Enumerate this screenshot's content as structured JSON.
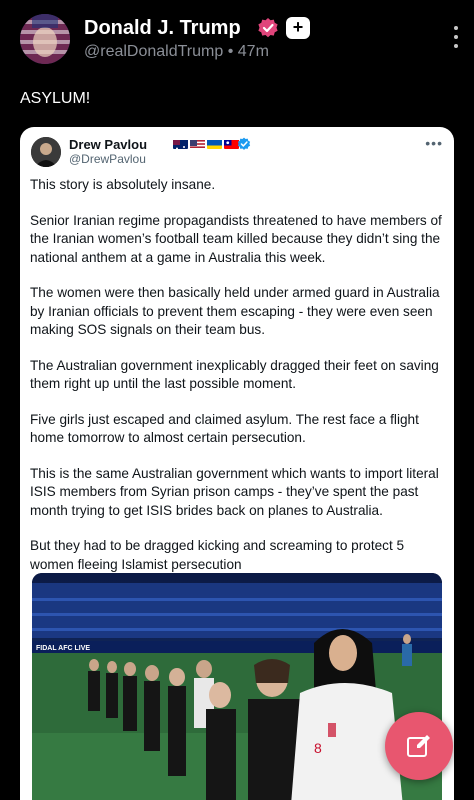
{
  "post": {
    "author_name": "Donald J. Trump",
    "handle": "@realDonaldTrump",
    "separator": "•",
    "time_ago": "47m",
    "plus_symbol": "+",
    "text": "ASYLUM!"
  },
  "quoted": {
    "author_name": "Drew Pavlou",
    "handle": "@DrewPavlou",
    "more_label": "•••",
    "paragraphs": [
      "This story is absolutely insane.",
      "Senior Iranian regime propagandists threatened to have members of the Iranian women’s football team killed because they didn’t sing the national anthem at a game in Australia this week.",
      "The women were then basically held under armed guard in Australia by Iranian officials to prevent them escaping - they were even seen making SOS signals on their team bus.",
      "The Australian government inexplicably dragged their feet on saving them right up until the last possible moment.",
      "Five girls just escaped and claimed asylum. The rest face a flight home tomorrow to almost certain persecution.",
      "This is the same Australian government which wants to import literal ISIS members from Syrian prison camps - they’ve spent the past month trying to get ISIS brides back on planes to Australia.",
      "But they had to be dragged kicking and screaming to protect 5 women fleeing Islamist persecution"
    ],
    "media_banner": "FIDAL AFC LIVE"
  },
  "icons": {
    "avatar": "portrait-avatar",
    "verified": "verified-check-icon",
    "plus": "plus-badge-icon",
    "more": "kebab-menu-icon",
    "compose": "pencil-compose-icon"
  },
  "colors": {
    "background": "#000000",
    "card": "#ffffff",
    "verified_badge": "#e0457b",
    "quote_verified": "#1d9bf0",
    "fab": "#e8566f",
    "muted_text": "#8b8f97"
  }
}
